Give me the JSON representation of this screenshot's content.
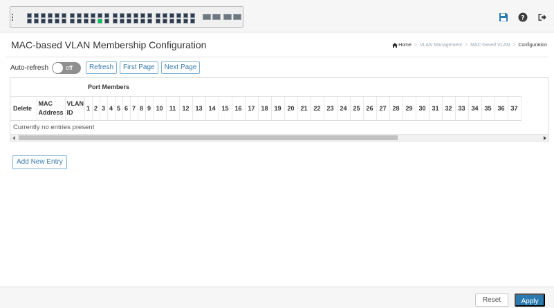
{
  "header": {
    "switch_panel": {
      "port_count": 52,
      "up_port": 22,
      "colors": {
        "panel": "#f0f0f0",
        "port": "#2e3b4d",
        "port_up": "#00c853"
      }
    },
    "icons": [
      "save-icon",
      "help-icon",
      "logout-icon"
    ],
    "accent_color": "#2a7ab0"
  },
  "page": {
    "title": "MAC-based VLAN Membership Configuration",
    "breadcrumb": [
      "Home",
      "VLAN Management",
      "MAC-based VLAN",
      "Configuration"
    ]
  },
  "controls": {
    "auto_refresh_label": "Auto-refresh",
    "toggle_state": "off",
    "refresh_label": "Refresh",
    "first_page_label": "First Page",
    "next_page_label": "Next Page"
  },
  "table": {
    "group_header": "Port Members",
    "col_delete": "Delete",
    "col_mac_line1": "MAC",
    "col_mac_line2": "Address",
    "col_vlan_line1": "VLAN",
    "col_vlan_line2": "ID",
    "ports": [
      "1",
      "2",
      "3",
      "4",
      "5",
      "6",
      "7",
      "8",
      "9",
      "10",
      "11",
      "12",
      "13",
      "14",
      "15",
      "16",
      "17",
      "18",
      "19",
      "20",
      "21",
      "22",
      "23",
      "24",
      "25",
      "26",
      "27",
      "28",
      "29",
      "30",
      "31",
      "32",
      "33",
      "34",
      "35",
      "36",
      "37"
    ],
    "empty_message": "Currently no entries present"
  },
  "actions": {
    "add_new_entry_label": "Add New Entry",
    "reset_label": "Reset",
    "apply_label": "Apply"
  }
}
